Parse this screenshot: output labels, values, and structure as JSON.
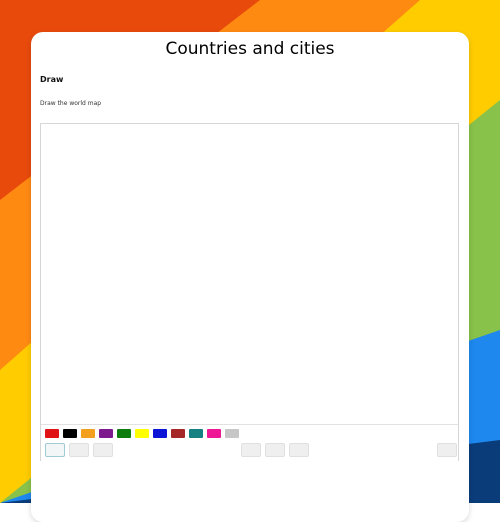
{
  "page": {
    "title": "Countries and cities",
    "section_heading": "Draw",
    "instruction": "Draw the world map"
  },
  "palette": [
    {
      "name": "red",
      "color": "#e01414"
    },
    {
      "name": "black",
      "color": "#000000"
    },
    {
      "name": "orange",
      "color": "#f2a01d"
    },
    {
      "name": "purple",
      "color": "#7d1b8e"
    },
    {
      "name": "green",
      "color": "#0d7d0d"
    },
    {
      "name": "yellow",
      "color": "#ffff00"
    },
    {
      "name": "blue",
      "color": "#0b14d6"
    },
    {
      "name": "brown",
      "color": "#a52828"
    },
    {
      "name": "teal",
      "color": "#168181"
    },
    {
      "name": "pink",
      "color": "#ee1796"
    },
    {
      "name": "gray",
      "color": "#c7c7c7"
    }
  ],
  "tools": [
    {
      "name": "pen-tool",
      "icon": "pen-icon"
    },
    {
      "name": "eraser-tool",
      "icon": "eraser-icon"
    },
    {
      "name": "fill-tool",
      "icon": "fill-icon"
    },
    {
      "name": "undo-button",
      "icon": "undo-icon"
    },
    {
      "name": "redo-button",
      "icon": "redo-icon"
    },
    {
      "name": "clear-button",
      "icon": "clear-icon"
    },
    {
      "name": "save-button",
      "icon": "save-icon"
    }
  ],
  "background_stripes": [
    "#e84a0c",
    "#ff8a12",
    "#ffcc00",
    "#88c24a",
    "#1e88ee",
    "#0b3c7a"
  ]
}
